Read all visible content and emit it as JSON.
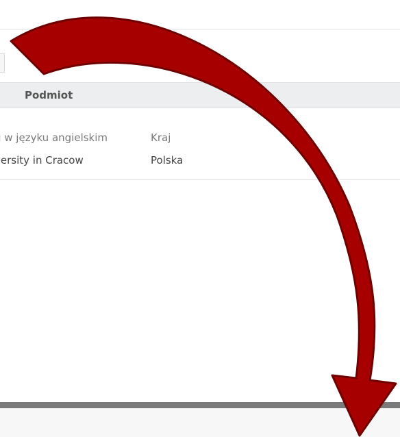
{
  "section": {
    "title": "Podmiot"
  },
  "entity": {
    "name_label_partial": "u w języku angielskim",
    "name_value_partial": "versity in Cracow",
    "country_label": "Kraj",
    "country_value": "Polska"
  },
  "overlay": {
    "arrow_color": "#a60000",
    "arrow_outline": "#6e0000"
  }
}
